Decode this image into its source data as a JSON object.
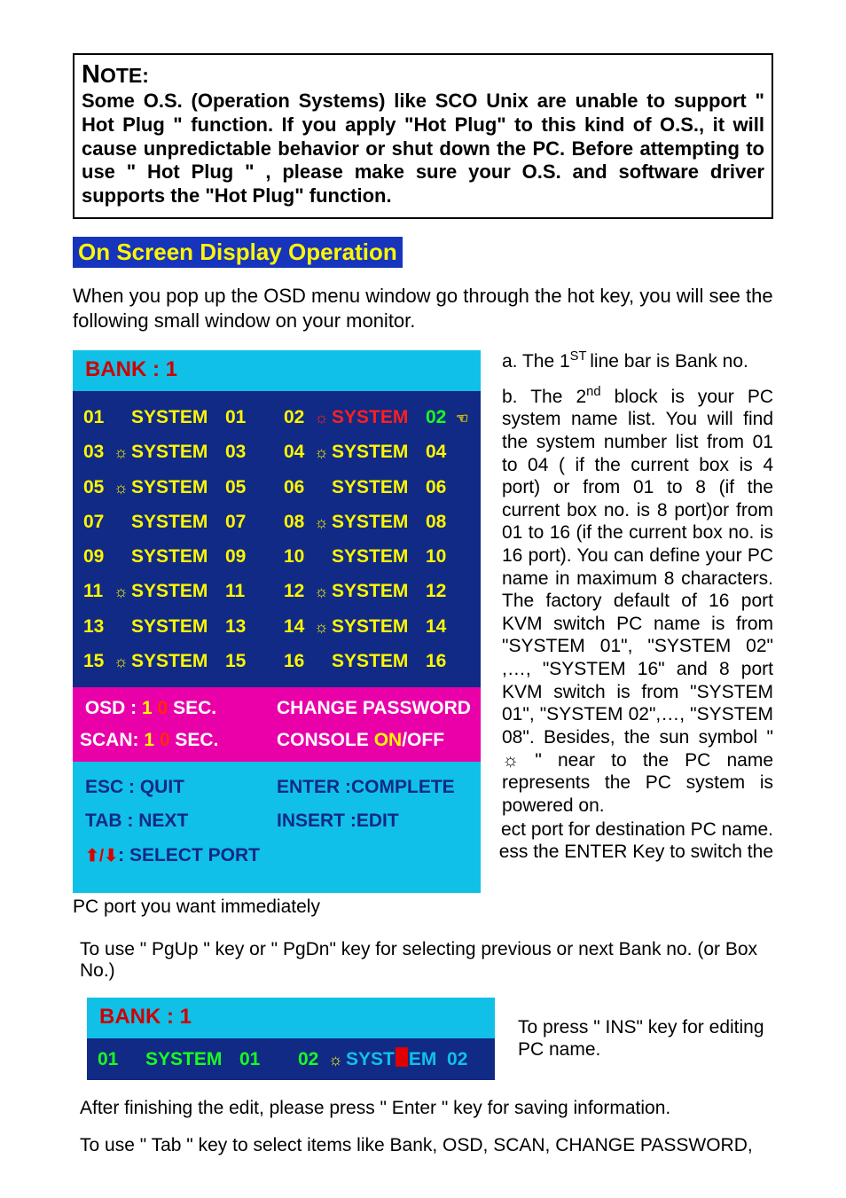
{
  "note": {
    "title_plain": "OTE:",
    "body": "Some O.S. (Operation Systems) like SCO Unix are unable to support \" Hot Plug \" function. If you apply \"Hot Plug\" to this kind of O.S., it will cause unpredictable behavior or shut down the PC. Before attempting to use \" Hot Plug \" , please make sure your O.S. and software driver supports the \"Hot Plug\" function."
  },
  "heading": "On Screen Display Operation",
  "intro": "When you pop up the OSD menu window go through the hot key, you will see the following small window on your monitor.",
  "osd": {
    "bank_label": "BANK : ",
    "bank_num": "1",
    "rows": [
      {
        "left": {
          "num": "01",
          "sun": false,
          "name": "SYSTEM",
          "idx": "01",
          "idxGreen": false
        },
        "right": {
          "num": "02",
          "sunRed": true,
          "nameRed": true,
          "name": "SYSTEM",
          "idx": "02",
          "idxGreen": true,
          "mouse": true
        }
      },
      {
        "left": {
          "num": "03",
          "sun": true,
          "name": "SYSTEM",
          "idx": "03"
        },
        "right": {
          "num": "04",
          "sun": true,
          "name": "SYSTEM",
          "idx": "04"
        }
      },
      {
        "left": {
          "num": "05",
          "sun": true,
          "name": "SYSTEM",
          "idx": "05"
        },
        "right": {
          "num": "06",
          "sun": false,
          "name": "SYSTEM",
          "idx": "06"
        }
      },
      {
        "left": {
          "num": "07",
          "sun": false,
          "name": "SYSTEM",
          "idx": "07"
        },
        "right": {
          "num": "08",
          "sun": true,
          "name": "SYSTEM",
          "idx": "08"
        }
      },
      {
        "left": {
          "num": "09",
          "sun": false,
          "name": "SYSTEM",
          "idx": "09"
        },
        "right": {
          "num": "10",
          "sun": false,
          "name": "SYSTEM",
          "idx": "10"
        }
      },
      {
        "left": {
          "num": "11",
          "sun": true,
          "name": "SYSTEM",
          "idx": "11"
        },
        "right": {
          "num": "12",
          "sun": true,
          "name": "SYSTEM",
          "idx": "12"
        }
      },
      {
        "left": {
          "num": "13",
          "sun": false,
          "name": "SYSTEM",
          "idx": "13"
        },
        "right": {
          "num": "14",
          "sun": true,
          "name": "SYSTEM",
          "idx": "14"
        }
      },
      {
        "left": {
          "num": "15",
          "sun": true,
          "name": "SYSTEM",
          "idx": "15"
        },
        "right": {
          "num": "16",
          "sun": false,
          "name": "SYSTEM",
          "idx": "16"
        }
      }
    ],
    "status": {
      "osd_label": "OSD : ",
      "osd_n1": "1",
      "osd_n2": "0",
      "osd_sec": " SEC.",
      "chpw": "CHANGE PASSWORD",
      "scan_label": "SCAN: ",
      "scan_n1": "1",
      "scan_n2": "0",
      "scan_sec": " SEC.",
      "console": "CONSOLE   ",
      "on": "ON",
      "slash": "/",
      "off": "OFF"
    },
    "footer": {
      "esc": "ESC : QUIT",
      "enter": "ENTER :COMPLETE",
      "tab": "TAB : NEXT",
      "insert": "INSERT :EDIT",
      "select": ": SELECT   PORT"
    }
  },
  "right": {
    "a_pre": "a.   The 1",
    "a_sup": "ST ",
    "a_post": "line bar is Bank no.",
    "b": "b.  The 2<sup>nd</sup> block is your PC system name list. You will find the system number list from 01 to 04 ( if the current box is 4 port) or from 01 to 8 (if the current box no. is 8 port)or from 01 to 16 (if the current box no. is 16 port). You can define  your  PC  name  in maximum 8 characters. The factory default of 16 port KVM switch  PC  name  is  from \"SYSTEM  01\",  \"SYSTEM 02\" ,…, \"SYSTEM 16\" and 8 port  KVM  switch  is  from \"SYSTEM  01\",  \"SYSTEM 02\",…, \"SYSTEM 08\". Besides, the sun symbol \" ☼ \" near to the PC name represents the PC system is powered on."
  },
  "after": {
    "line1_tail": "ect port for destination PC name.",
    "line2_tail": "ess the ENTER Key to switch the",
    "line3": "PC port you want immediately"
  },
  "pgup": "To use \" PgUp \" key or \" PgDn\" key for selecting previous or next Bank no. (or Box No.)",
  "mini": {
    "bank_label": "BANK : ",
    "bank_num": "1",
    "l_num": "01",
    "l_name": "SYSTEM",
    "l_idx": "01",
    "r_num": "02",
    "r_name_a": "SYST",
    "r_name_b": "EM",
    "r_idx": "02"
  },
  "right2": "To press \" INS\" key for editing PC name.",
  "after_edit": "After finishing the edit, please press \" Enter \" key for saving information.",
  "tabline": "To use \" Tab \" key to select items like Bank, OSD, SCAN, CHANGE PASSWORD,"
}
